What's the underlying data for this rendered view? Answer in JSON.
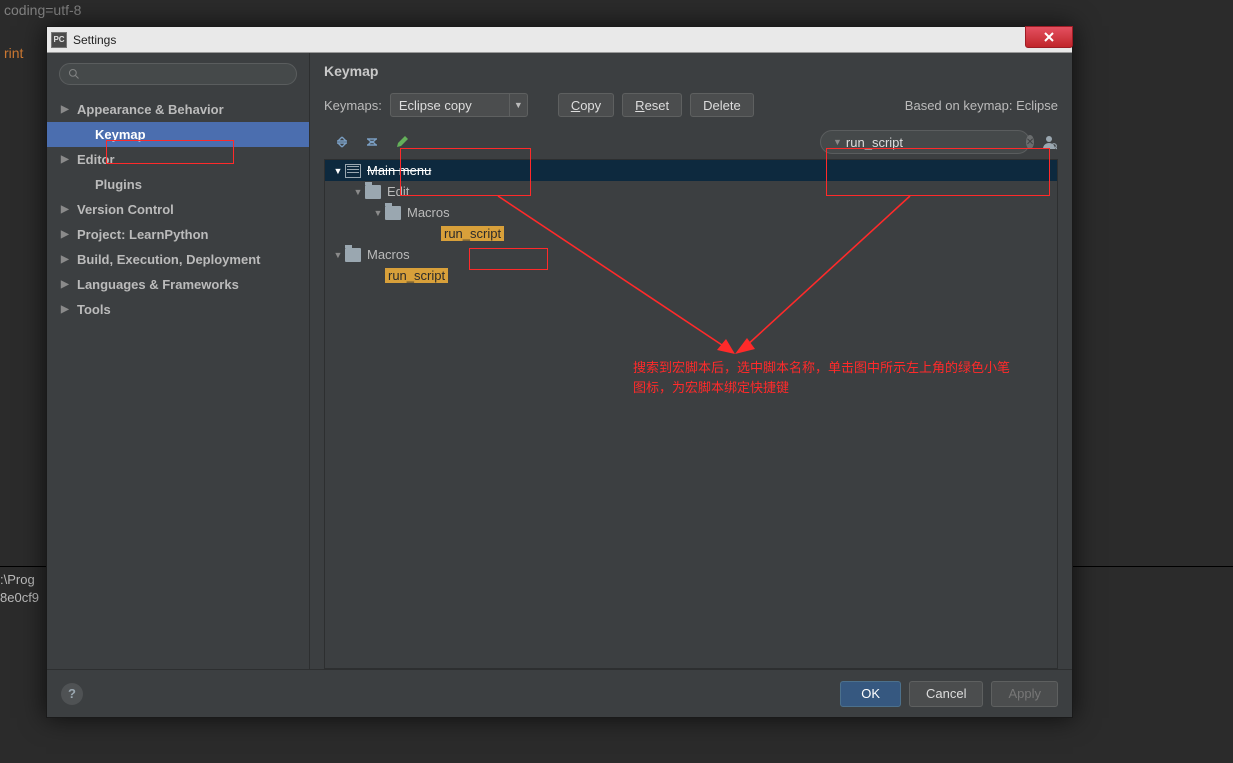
{
  "bg": {
    "line1": "coding=utf-8",
    "line2": "rint",
    "console1": ":\\Prog",
    "console2": "8e0cf9"
  },
  "dialog": {
    "app_icon": "PC",
    "title": "Settings",
    "close": "X"
  },
  "sidebar": {
    "items": [
      {
        "label": "Appearance & Behavior",
        "indent": 0,
        "arrow": true
      },
      {
        "label": "Keymap",
        "indent": 1,
        "arrow": false,
        "selected": true
      },
      {
        "label": "Editor",
        "indent": 0,
        "arrow": true
      },
      {
        "label": "Plugins",
        "indent": 1,
        "arrow": false
      },
      {
        "label": "Version Control",
        "indent": 0,
        "arrow": true
      },
      {
        "label": "Project: LearnPython",
        "indent": 0,
        "arrow": true
      },
      {
        "label": "Build, Execution, Deployment",
        "indent": 0,
        "arrow": true
      },
      {
        "label": "Languages & Frameworks",
        "indent": 0,
        "arrow": true
      },
      {
        "label": "Tools",
        "indent": 0,
        "arrow": true
      }
    ]
  },
  "panel": {
    "title": "Keymap",
    "keymaps_label": "Keymaps:",
    "keymaps_value": "Eclipse copy",
    "copy_btn": "Copy",
    "reset_btn": "Reset",
    "delete_btn": "Delete",
    "based_on": "Based on keymap: Eclipse"
  },
  "search": {
    "value": "run_script"
  },
  "tree": {
    "main_menu": "Main menu",
    "edit": "Edit",
    "macros1": "Macros",
    "run_script1": "run_script",
    "macros2": "Macros",
    "run_script2": "run_script"
  },
  "annotation": {
    "line1": "搜索到宏脚本后，选中脚本名称，单击图中所示左上角的绿色小笔",
    "line2": "图标，为宏脚本绑定快捷键"
  },
  "footer": {
    "ok": "OK",
    "cancel": "Cancel",
    "apply": "Apply"
  }
}
